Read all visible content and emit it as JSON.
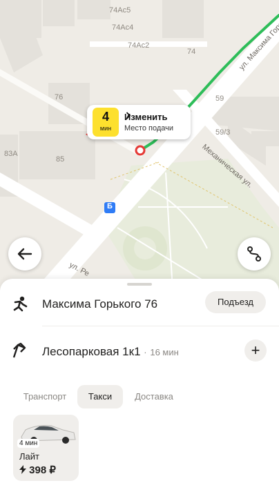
{
  "map": {
    "building_numbers": [
      "74Ac5",
      "74Ac4",
      "74Ac2",
      "74",
      "76",
      "59",
      "59/3",
      "83A",
      "85"
    ],
    "streets": [
      "ул. Максима Горького",
      "Механическая ул.",
      "ул. Ре"
    ],
    "pickup_bubble": {
      "eta_value": "4",
      "eta_unit": "мин",
      "change_label": "Изменить",
      "change_icon": "chevron-right-icon",
      "pickup_label": "Место подачи"
    },
    "back_button_icon": "arrow-left-icon",
    "route_button_icon": "route-icon",
    "route_color": "#2ebd59",
    "pin_color": "#e53935",
    "stop_label": "Б"
  },
  "sheet": {
    "from_address": "Максима Горького 76",
    "entrance_label": "Подъезд",
    "to_address": "Лесопарковая 1к1",
    "to_separator": "·",
    "to_time": "16 мин",
    "add_stop_label": "+",
    "tabs": [
      {
        "label": "Транспорт",
        "active": false
      },
      {
        "label": "Такси",
        "active": true
      },
      {
        "label": "Доставка",
        "active": false
      }
    ],
    "tariff": {
      "eta": "4 мин",
      "name": "Лайт",
      "price": "398 ₽",
      "price_icon": "lightning-icon"
    }
  }
}
